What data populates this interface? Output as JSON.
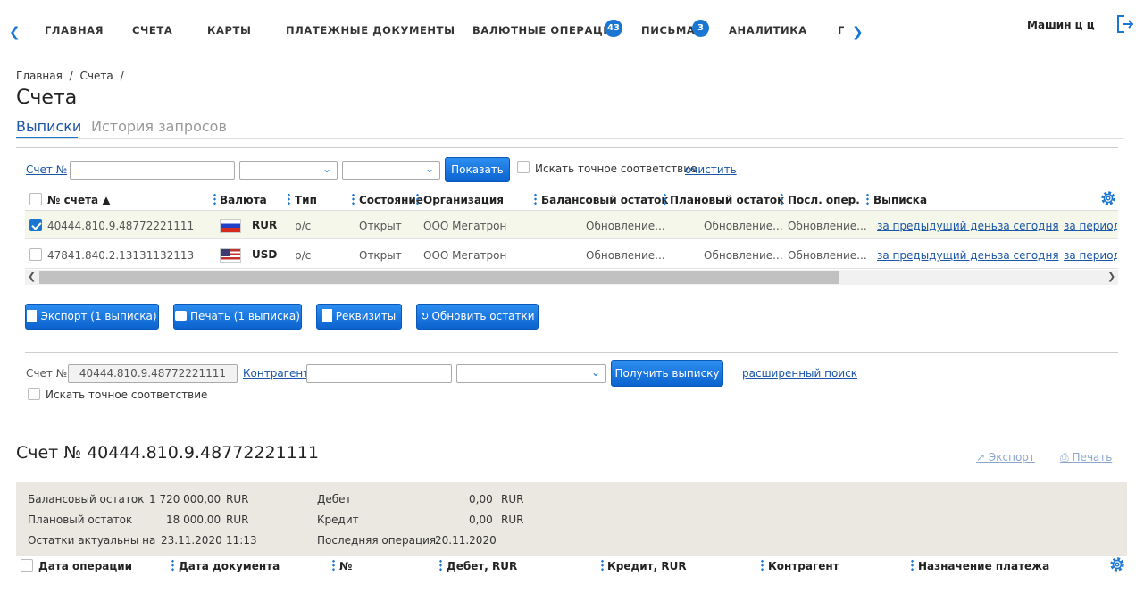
{
  "nav": {
    "items": [
      "ГЛАВНАЯ",
      "СЧЕТА",
      "КАРТЫ",
      "ПЛАТЕЖНЫЕ ДОКУМЕНТЫ",
      "ВАЛЮТНЫЕ ОПЕРАЦИИ",
      "ПИСЬМА",
      "АНАЛИТИКА",
      "Г"
    ],
    "badges": {
      "currency": "43",
      "letters": "3"
    },
    "user": "Машин ц ц"
  },
  "breadcrumb": {
    "home": "Главная",
    "sep1": "/",
    "accounts": "Счета",
    "sep2": "/"
  },
  "page_title": "Счета",
  "tabs": {
    "statements": "Выписки",
    "history": "История запросов"
  },
  "filter": {
    "account_label": "Счет №",
    "show_button": "Показать",
    "exact_match": "Искать точное соответствие",
    "clear": "очистить"
  },
  "table": {
    "headers": {
      "account": "№ счета ▲",
      "currency": "Валюта",
      "type": "Тип",
      "state": "Состояние",
      "org": "Организация",
      "balance": "Балансовый остаток",
      "planned": "Плановый остаток",
      "last_op": "Посл. опер.",
      "statement": "Выписка"
    },
    "rows": [
      {
        "account": "40444.810.9.48772221111",
        "currency": "RUR",
        "type": "р/с",
        "state": "Открыт",
        "org": "ООО Мегатрон",
        "balance": "Обновление...",
        "planned": "Обновление...",
        "last_op": "Обновление...",
        "prev_day": "за предыдущий день",
        "today": "за сегодня",
        "period": "за период"
      },
      {
        "account": "47841.840.2.13131132113",
        "currency": "USD",
        "type": "р/с",
        "state": "Открыт",
        "org": "ООО Мегатрон",
        "balance": "Обновление...",
        "planned": "Обновление...",
        "last_op": "Обновление...",
        "prev_day": "за предыдущий день",
        "today": "за сегодня",
        "period": "за период"
      }
    ]
  },
  "actions": {
    "export": "Экспорт (1 выписка)",
    "print": "Печать (1 выписка)",
    "details": "Реквизиты",
    "refresh": "Обновить остатки"
  },
  "search": {
    "account_label": "Счет №",
    "account_value": "40444.810.9.48772221111",
    "counterparty": "Контрагент",
    "get_button": "Получить выписку",
    "advanced": "расширенный поиск",
    "exact_match": "Искать точное соответствие"
  },
  "statement": {
    "title": "Счет № 40444.810.9.48772221111",
    "export": "Экспорт",
    "print": "Печать",
    "summary": {
      "balance_label": "Балансовый остаток",
      "balance_value": "1 720 000,00",
      "balance_cur": "RUR",
      "planned_label": "Плановый остаток",
      "planned_value": "18 000,00",
      "planned_cur": "RUR",
      "actual_label": "Остатки актуальны на",
      "actual_date": "23.11.2020",
      "actual_time": "11:13",
      "debit_label": "Дебет",
      "debit_value": "0,00",
      "debit_cur": "RUR",
      "credit_label": "Кредит",
      "credit_value": "0,00",
      "credit_cur": "RUR",
      "lastop_label": "Последняя операция",
      "lastop_date": "20.11.2020"
    },
    "columns": {
      "op_date": "Дата операции",
      "doc_date": "Дата документа",
      "num": "№",
      "debit": "Дебет, RUR",
      "credit": "Кредит, RUR",
      "counterparty": "Контрагент",
      "purpose": "Назначение платежа"
    }
  }
}
